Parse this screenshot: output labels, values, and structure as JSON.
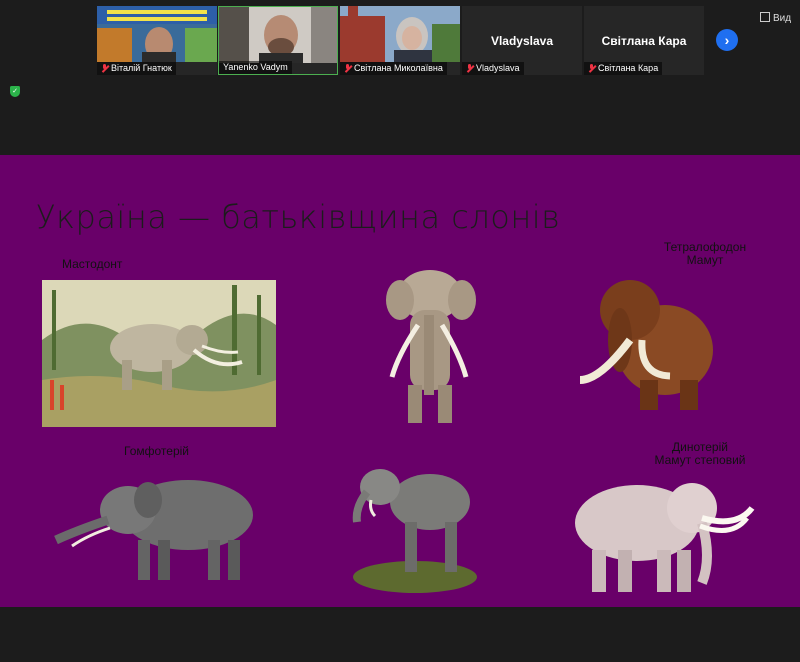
{
  "participants": [
    {
      "name": "Віталій Гнатюк",
      "muted": true
    },
    {
      "name": "Yanenko Vadym",
      "muted": false
    },
    {
      "name": "Світлана Миколаївна",
      "muted": true
    },
    {
      "name": "Vladyslava",
      "muted": true,
      "display": "Vladyslava"
    },
    {
      "name": "Світлана Кара",
      "muted": true,
      "display": "Світлана Кара"
    }
  ],
  "view_label": "Вид",
  "next_icon": "chevron-right-icon",
  "security_icon": "shield-icon",
  "slide": {
    "title": "Україна — батьківщина слонів",
    "labels": {
      "mastodon": "Мастодонт",
      "tetralophodon": "Тетралофодон",
      "mammoth": "Мамут",
      "gomphothere": "Гомфотерій",
      "deinotherium": "Динотерій",
      "steppe_mammoth": "Мамут степовий"
    },
    "background": "#690069"
  }
}
